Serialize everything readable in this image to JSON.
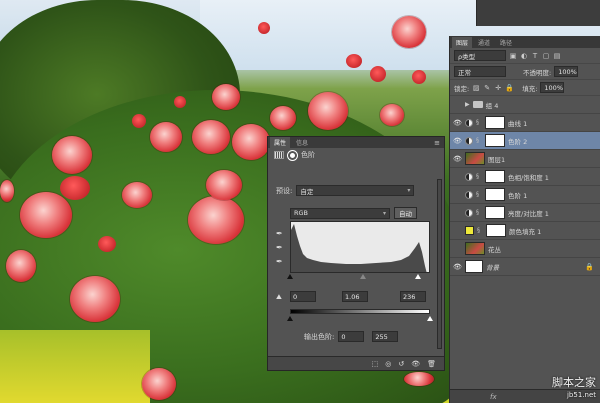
{
  "layers_panel": {
    "tabs": [
      "图层",
      "通道",
      "路径"
    ],
    "filter_kind": "ρ类型",
    "blend_mode": "正常",
    "opacity_label": "不透明度:",
    "opacity_value": "100%",
    "lock_label": "锁定:",
    "fill_label": "填充:",
    "fill_value": "100%",
    "layers": [
      {
        "name": "组 4",
        "kind": "group",
        "visible": false
      },
      {
        "name": "曲线 1",
        "kind": "adjustment",
        "visible": true
      },
      {
        "name": "色阶 2",
        "kind": "adjustment",
        "visible": true,
        "selected": true
      },
      {
        "name": "图层1",
        "kind": "pixel",
        "visible": true
      },
      {
        "name": "色相/饱和度 1",
        "kind": "adjustment",
        "visible": false
      },
      {
        "name": "色阶 1",
        "kind": "adjustment",
        "visible": false
      },
      {
        "name": "亮度/对比度 1",
        "kind": "adjustment",
        "visible": false
      },
      {
        "name": "颜色填充 1",
        "kind": "fill",
        "visible": false
      },
      {
        "name": "花丛",
        "kind": "pixel",
        "visible": false
      },
      {
        "name": "背景",
        "kind": "background",
        "visible": true
      }
    ],
    "footer_label": "fx"
  },
  "properties_panel": {
    "tabs": [
      "属性",
      "信息"
    ],
    "title": "色阶",
    "preset_label": "预设:",
    "preset_value": "自定",
    "channel_value": "RGB",
    "auto_button": "自动",
    "input_black": "0",
    "input_gamma": "1.06",
    "input_white": "236",
    "output_label": "输出色阶:",
    "output_black": "0",
    "output_white": "255"
  },
  "watermark": {
    "line1": "脚本之家",
    "line2": "jb51.net"
  }
}
